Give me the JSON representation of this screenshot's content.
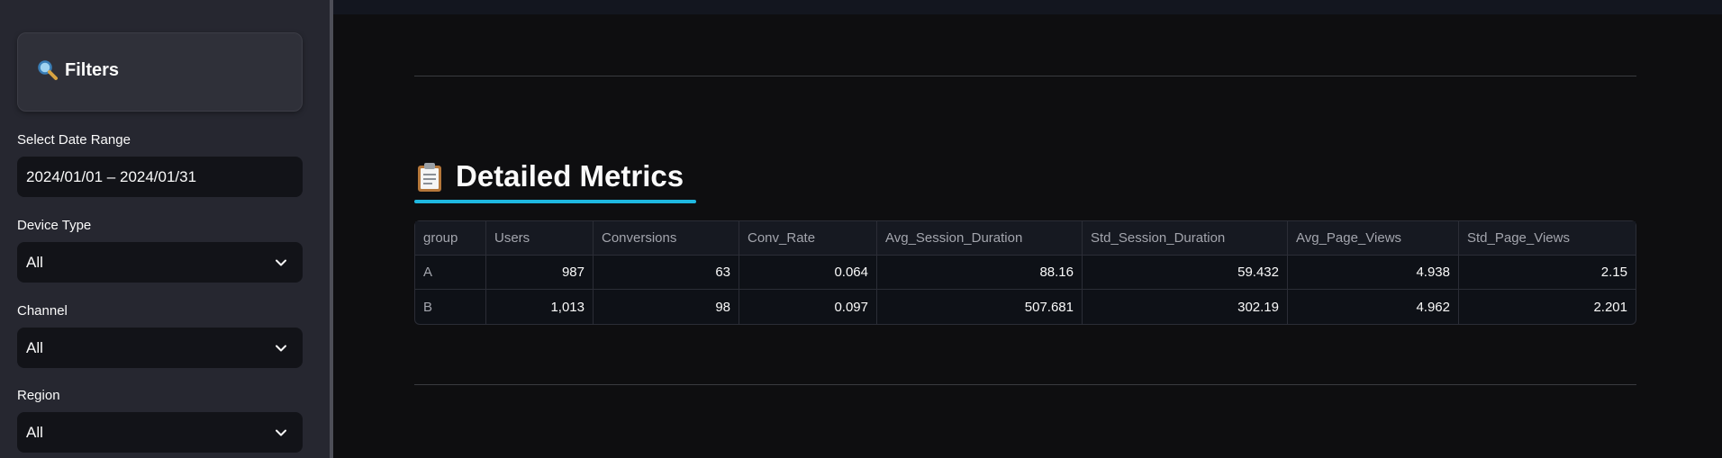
{
  "sidebar": {
    "filters_title": "Filters",
    "date_range": {
      "label": "Select Date Range",
      "value": "2024/01/01 – 2024/01/31"
    },
    "device_type": {
      "label": "Device Type",
      "value": "All"
    },
    "channel": {
      "label": "Channel",
      "value": "All"
    },
    "region": {
      "label": "Region",
      "value": "All"
    }
  },
  "main": {
    "section_title": "Detailed Metrics",
    "accent_color": "#1fb8e0",
    "table": {
      "columns": [
        "group",
        "Users",
        "Conversions",
        "Conv_Rate",
        "Avg_Session_Duration",
        "Std_Session_Duration",
        "Avg_Page_Views",
        "Std_Page_Views"
      ],
      "rows": [
        [
          "A",
          "987",
          "63",
          "0.064",
          "88.16",
          "59.432",
          "4.938",
          "2.15"
        ],
        [
          "B",
          "1,013",
          "98",
          "0.097",
          "507.681",
          "302.19",
          "4.962",
          "2.201"
        ]
      ]
    }
  },
  "icons": {
    "filters": "magnifier-icon",
    "section": "clipboard-icon",
    "select": "chevron-down-icon"
  }
}
